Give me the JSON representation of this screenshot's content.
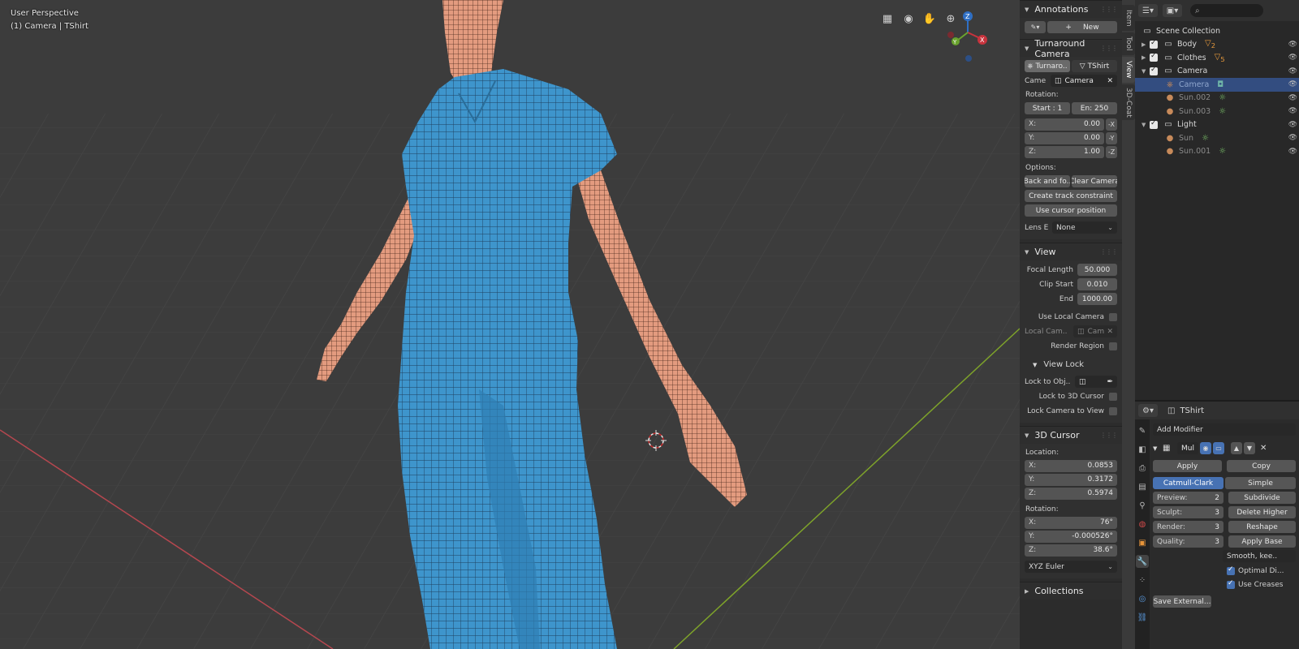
{
  "viewport": {
    "perspective": "User Perspective",
    "object": "(1) Camera | TShirt",
    "gizmo": {
      "z": "Z",
      "y": "Y",
      "x": "X"
    }
  },
  "side_tabs": [
    "Item",
    "Tool",
    "View",
    "3D-Coat"
  ],
  "annotations": {
    "header": "Annotations",
    "new_label": "New",
    "plus": "+"
  },
  "turnaround": {
    "header": "Turnaround Camera",
    "tab1": "Turnaro..",
    "tab2": "TShirt",
    "camera_label": "Came",
    "camera_value": "Camera",
    "rotation_label": "Rotation:",
    "start": "Start : 1",
    "end": "En:  250",
    "x_label": "X:",
    "x_value": "0.00",
    "x_btn": "-X",
    "y_label": "Y:",
    "y_value": "0.00",
    "y_btn": "-Y",
    "z_label": "Z:",
    "z_value": "1.00",
    "z_btn": "-Z",
    "options_label": "Options:",
    "back_btn": "Back and fo..",
    "clear_btn": "Clear Camera",
    "track_btn": "Create track constraint",
    "cursor_btn": "Use cursor position",
    "lens_label": "Lens E",
    "lens_value": "None"
  },
  "view": {
    "header": "View",
    "focal_label": "Focal Length",
    "focal_value": "50.000",
    "clip_start_label": "Clip Start",
    "clip_start_value": "0.010",
    "clip_end_label": "End",
    "clip_end_value": "1000.00",
    "local_camera_label": "Use Local Camera",
    "local_cam_label": "Local Cam..",
    "local_cam_value": "Cam",
    "render_region_label": "Render Region",
    "view_lock_header": "View Lock",
    "lock_obj_label": "Lock to Obj..",
    "lock_3d_cursor_label": "Lock to 3D Cursor",
    "lock_camera_label": "Lock Camera to View"
  },
  "cursor": {
    "header": "3D Cursor",
    "location_label": "Location:",
    "loc_x_label": "X:",
    "loc_x": "0.0853",
    "loc_y_label": "Y:",
    "loc_y": "0.3172",
    "loc_z_label": "Z:",
    "loc_z": "0.5974",
    "rotation_label": "Rotation:",
    "rot_x_label": "X:",
    "rot_x": "76°",
    "rot_y_label": "Y:",
    "rot_y": "-0.000526°",
    "rot_z_label": "Z:",
    "rot_z": "38.6°",
    "mode": "XYZ Euler"
  },
  "collections": {
    "header": "Collections"
  },
  "outliner": {
    "rows": [
      {
        "label": "Scene Collection",
        "type": "root"
      },
      {
        "label": "Body",
        "type": "collection",
        "badge": "2"
      },
      {
        "label": "Clothes",
        "type": "collection",
        "badge": "5"
      },
      {
        "label": "Camera",
        "type": "collection"
      },
      {
        "label": "Camera",
        "type": "object",
        "selected": true
      },
      {
        "label": "Sun.002",
        "type": "light"
      },
      {
        "label": "Sun.003",
        "type": "light"
      },
      {
        "label": "Light",
        "type": "collection"
      },
      {
        "label": "Sun",
        "type": "light"
      },
      {
        "label": "Sun.001",
        "type": "light"
      }
    ]
  },
  "properties": {
    "object_name": "TShirt",
    "add_modifier": "Add Modifier",
    "modifier_name": "Mul",
    "apply": "Apply",
    "copy": "Copy",
    "catmull": "Catmull-Clark",
    "simple": "Simple",
    "preview_label": "Preview:",
    "preview_value": "2",
    "sculpt_label": "Sculpt:",
    "sculpt_value": "3",
    "render_label": "Render:",
    "render_value": "3",
    "quality_label": "Quality:",
    "quality_value": "3",
    "subdivide": "Subdivide",
    "delete_higher": "Delete Higher",
    "reshape": "Reshape",
    "apply_base": "Apply Base",
    "smooth": "Smooth, kee..",
    "optimal": "Optimal Di...",
    "creases": "Use Creases",
    "save_external": "Save External..."
  }
}
